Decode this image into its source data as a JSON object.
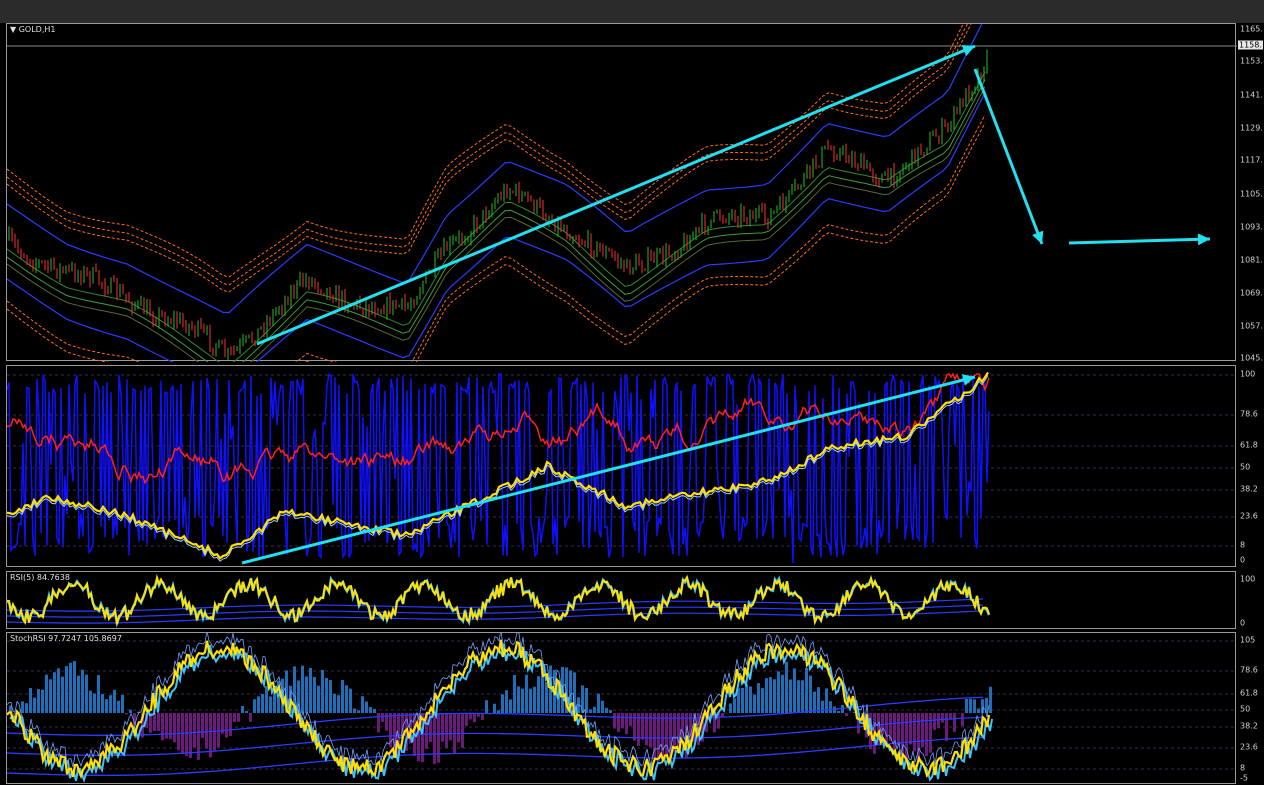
{
  "app": {
    "symbol_title": "GOLD,H1"
  },
  "colors": {
    "background": "#000000",
    "arrow": "#22e0f0",
    "rsi_red": "#ff2020",
    "rsi_blue": "#1010ff",
    "signal_yellow": "#ffe000",
    "band_orange": "#ff6a1a",
    "band_blue": "#2b3cff",
    "hist_up": "#1e6fb8",
    "hist_down": "#6a1a7a"
  },
  "main_chart": {
    "current_price_label": "1158.",
    "price_axis": [
      "1165.",
      "1153.",
      "1141.",
      "1129.",
      "1117.",
      "1105.",
      "1093.",
      "1081.",
      "1069.",
      "1057.",
      "1045."
    ]
  },
  "indicator1": {
    "axis": [
      "100",
      "78.6",
      "61.8",
      "50",
      "38.2",
      "23.6",
      "8",
      "0"
    ]
  },
  "indicator2": {
    "label": "RSI(5) 84.7638",
    "axis": [
      "100",
      "0"
    ]
  },
  "indicator3": {
    "label": "StochRSI 97.7247 105.8697",
    "axis": [
      "105",
      "78.6",
      "61.8",
      "50",
      "38.2",
      "23.6",
      "8",
      "-5"
    ]
  }
}
